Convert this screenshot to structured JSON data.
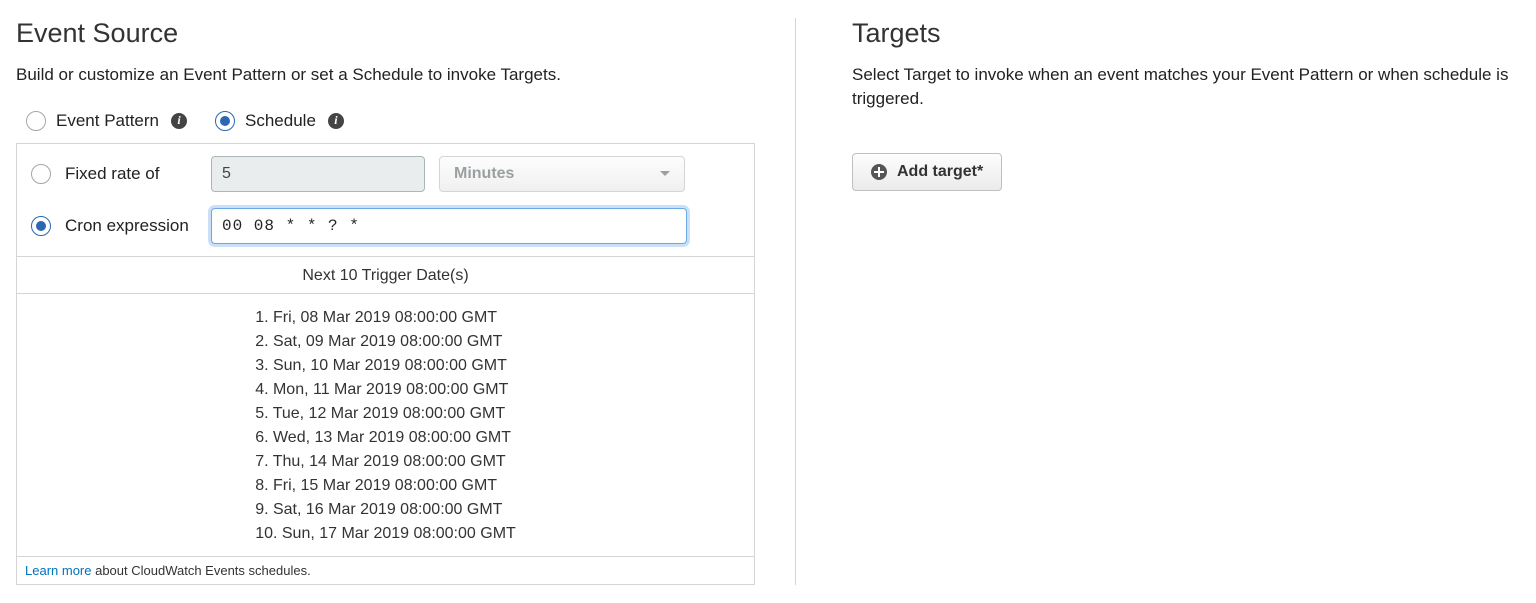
{
  "event_source": {
    "title": "Event Source",
    "description": "Build or customize an Event Pattern or set a Schedule to invoke Targets.",
    "mode": {
      "event_pattern_label": "Event Pattern",
      "schedule_label": "Schedule",
      "selected": "schedule"
    },
    "schedule": {
      "fixed_rate_label": "Fixed rate of",
      "fixed_rate_value": "5",
      "fixed_rate_unit": "Minutes",
      "cron_label": "Cron expression",
      "cron_value": "00 08 * * ? *",
      "selected": "cron"
    },
    "next_dates_header": "Next 10 Trigger Date(s)",
    "next_dates": [
      "Fri, 08 Mar 2019 08:00:00 GMT",
      "Sat, 09 Mar 2019 08:00:00 GMT",
      "Sun, 10 Mar 2019 08:00:00 GMT",
      "Mon, 11 Mar 2019 08:00:00 GMT",
      "Tue, 12 Mar 2019 08:00:00 GMT",
      "Wed, 13 Mar 2019 08:00:00 GMT",
      "Thu, 14 Mar 2019 08:00:00 GMT",
      "Fri, 15 Mar 2019 08:00:00 GMT",
      "Sat, 16 Mar 2019 08:00:00 GMT",
      "Sun, 17 Mar 2019 08:00:00 GMT"
    ],
    "footer_link_text": "Learn more",
    "footer_text": " about CloudWatch Events schedules."
  },
  "targets": {
    "title": "Targets",
    "description": "Select Target to invoke when an event matches your Event Pattern or when schedule is triggered.",
    "add_button_label": "Add target*"
  }
}
